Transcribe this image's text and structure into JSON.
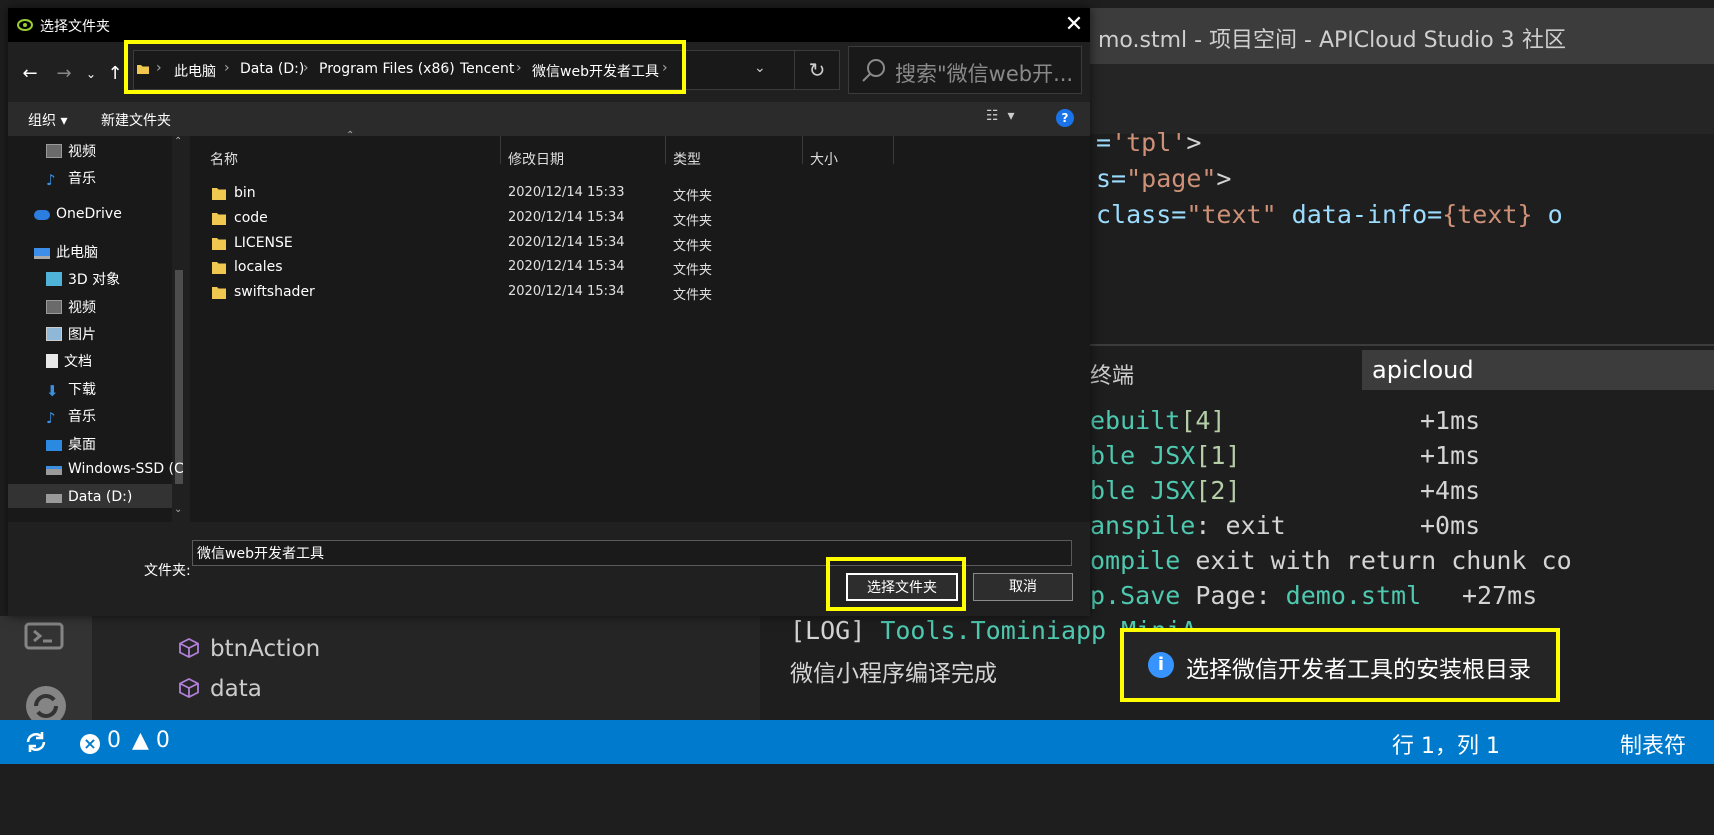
{
  "ide": {
    "title": "mo.stml - 项目空间 - APICloud Studio 3",
    "community": "社区",
    "code": [
      {
        "a": "=",
        "b": "'tpl'",
        "c": ">"
      },
      {
        "a": "s=",
        "b": "\"page\"",
        "c": ">"
      },
      {
        "pre": "class=",
        "b": "\"text\"",
        "mid": " data-info=",
        "brace": "{text}",
        "post": " o"
      }
    ],
    "terminal_tab": "终端",
    "terminal_select": "apicloud",
    "terminal_lines": [
      {
        "text": "ebuilt",
        "bracket": "[4]",
        "time": "+1ms"
      },
      {
        "text": "ble JSX",
        "bracket": "[1]",
        "time": "+1ms"
      },
      {
        "text": "ble JSX",
        "bracket": "[2]",
        "time": "+4ms"
      },
      {
        "text": "anspile",
        "rest": ": exit",
        "time": "+0ms"
      },
      {
        "text": "ompile",
        "rest": " exit with return chunk co"
      },
      {
        "text": "p.Save",
        "rest": " Page: ",
        "file": "demo.stml",
        "time": "+27ms"
      }
    ],
    "log_prefix": "[LOG]",
    "log_text": "Tools.Tominiapp",
    "log_tail": " MiniA",
    "compile_done": "微信小程序编译完成",
    "outline_items": [
      "btnAction",
      "data"
    ],
    "status": {
      "errors": "0",
      "warnings": "0",
      "cursor": "行 1，列 1",
      "tab": "制表符"
    },
    "notification": "选择微信开发者工具的安装根目录"
  },
  "dialog": {
    "title": "选择文件夹",
    "breadcrumbs": [
      "此电脑",
      "Data (D:)",
      "Program Files (x86)",
      "Tencent",
      "微信web开发者工具"
    ],
    "search_placeholder": "搜索\"微信web开...",
    "toolbar": {
      "organize": "组织 ▾",
      "new_folder": "新建文件夹"
    },
    "nav_items": [
      {
        "label": "视频",
        "icon": "video-icon"
      },
      {
        "label": "音乐",
        "icon": "music-icon"
      },
      {
        "label": "OneDrive",
        "icon": "cloud-icon"
      },
      {
        "label": "此电脑",
        "icon": "computer-icon"
      },
      {
        "label": "3D 对象",
        "icon": "cube-3d-icon"
      },
      {
        "label": "视频",
        "icon": "video-icon"
      },
      {
        "label": "图片",
        "icon": "picture-icon"
      },
      {
        "label": "文档",
        "icon": "document-icon"
      },
      {
        "label": "下载",
        "icon": "download-icon"
      },
      {
        "label": "音乐",
        "icon": "music-icon"
      },
      {
        "label": "桌面",
        "icon": "desktop-icon"
      },
      {
        "label": "Windows-SSD (C",
        "icon": "drive-icon"
      },
      {
        "label": "Data (D:)",
        "icon": "drive-icon"
      }
    ],
    "columns": {
      "name": "名称",
      "modified": "修改日期",
      "type": "类型",
      "size": "大小"
    },
    "files": [
      {
        "name": "bin",
        "modified": "2020/12/14 15:33",
        "type": "文件夹"
      },
      {
        "name": "code",
        "modified": "2020/12/14 15:34",
        "type": "文件夹"
      },
      {
        "name": "LICENSE",
        "modified": "2020/12/14 15:34",
        "type": "文件夹"
      },
      {
        "name": "locales",
        "modified": "2020/12/14 15:34",
        "type": "文件夹"
      },
      {
        "name": "swiftshader",
        "modified": "2020/12/14 15:34",
        "type": "文件夹"
      }
    ],
    "folder_label": "文件夹:",
    "folder_value": "微信web开发者工具",
    "select_button": "选择文件夹",
    "cancel_button": "取消",
    "highlight_color": "#ffff00"
  }
}
